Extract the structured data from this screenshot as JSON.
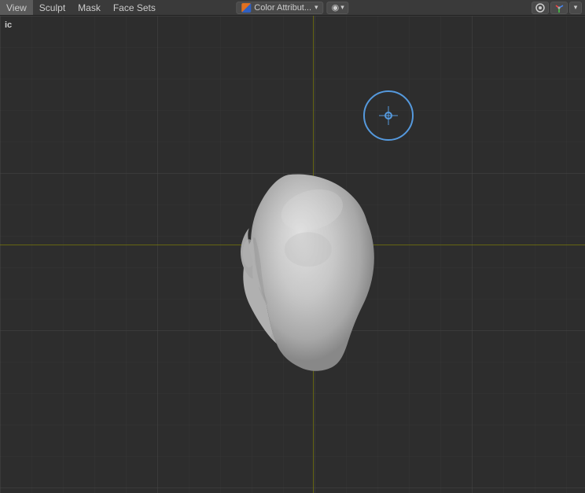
{
  "menubar": {
    "items": [
      "View",
      "Sculpt",
      "Mask",
      "Face Sets"
    ],
    "color_attribute_label": "Color Attribut...",
    "viewport_label": "ic",
    "brush_icon": "●",
    "viewport_shading_icon": "◉"
  },
  "header": {
    "right_icons": [
      "👁",
      "⊕"
    ]
  },
  "viewport": {
    "label": "ic"
  }
}
